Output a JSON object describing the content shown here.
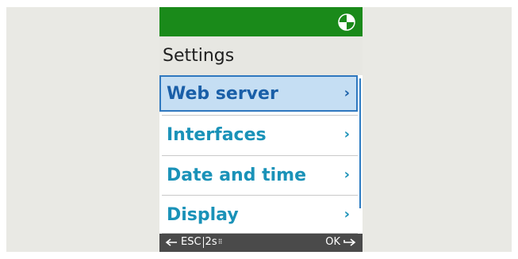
{
  "title": "Settings",
  "status": {
    "icon": "half-filled-circle-icon"
  },
  "menu": {
    "items": [
      {
        "label": "Web server",
        "chevron": "›",
        "selected": true
      },
      {
        "label": "Interfaces",
        "chevron": "›",
        "selected": false
      },
      {
        "label": "Date and time",
        "chevron": "›",
        "selected": false
      },
      {
        "label": "Display",
        "chevron": "›",
        "selected": false
      }
    ]
  },
  "softkeys": {
    "left_esc": "ESC",
    "left_hold": "2s",
    "right_ok": "OK"
  },
  "colors": {
    "topbar": "#1a8a1a",
    "menu_text": "#1a92b8",
    "selection_bg": "#c5def3",
    "selection_border": "#2f78bf",
    "softkey_bar": "#4a4a4a"
  }
}
